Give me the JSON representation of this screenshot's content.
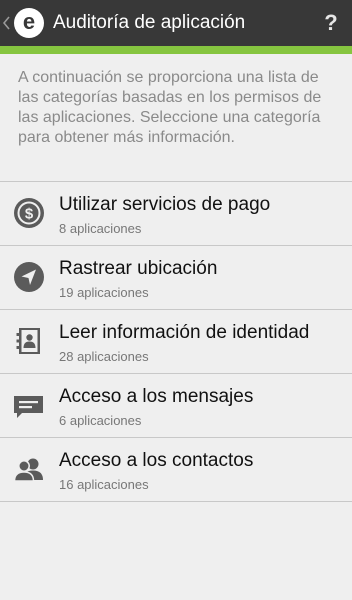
{
  "header": {
    "title": "Auditoría de aplicación",
    "help_label": "?",
    "logo_letter": "e",
    "accent_color": "#86c540",
    "bar_color": "#383838"
  },
  "intro_text": "A continuación se proporciona una lista de las categorías basadas en los permisos de las aplicaciones. Seleccione una categoría para obtener más información.",
  "categories": [
    {
      "icon": "dollar-coin-icon",
      "title": "Utilizar servicios de pago",
      "subtitle": "8 aplicaciones"
    },
    {
      "icon": "location-arrow-icon",
      "title": "Rastrear ubicación",
      "subtitle": "19 aplicaciones"
    },
    {
      "icon": "contact-book-icon",
      "title": "Leer información de identidad",
      "subtitle": "28 aplicaciones"
    },
    {
      "icon": "message-icon",
      "title": "Acceso a los mensajes",
      "subtitle": "6 aplicaciones"
    },
    {
      "icon": "contacts-people-icon",
      "title": "Acceso a los contactos",
      "subtitle": "16 aplicaciones"
    }
  ]
}
